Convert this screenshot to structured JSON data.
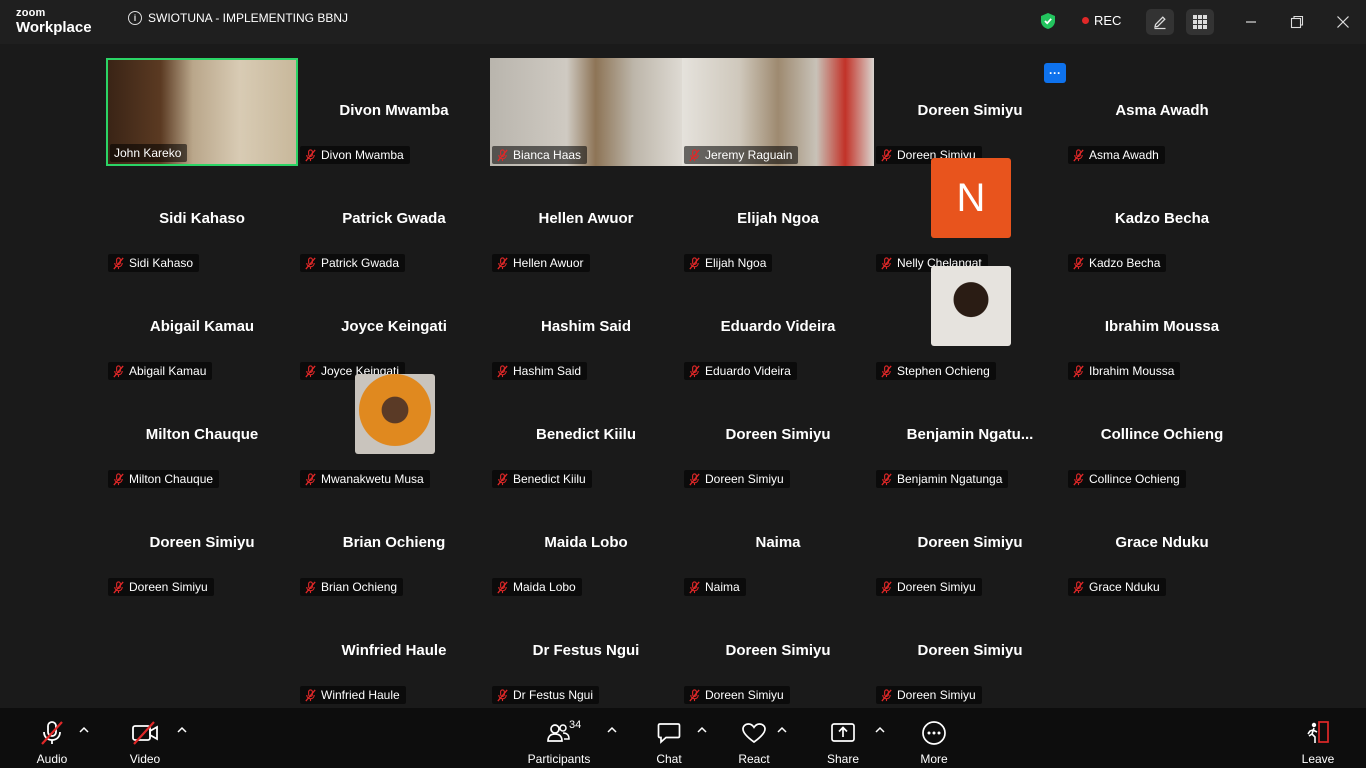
{
  "app": {
    "brand_small": "zoom",
    "brand": "Workplace"
  },
  "meeting": {
    "title": "SWIOTUNA - IMPLEMENTING BBNJ",
    "rec_label": "REC"
  },
  "colors": {
    "speaker_border": "#2bd466",
    "rec": "#e02828",
    "avatar_n": "#e8541d",
    "accent": "#0e72ed",
    "leave": "#e02828"
  },
  "tiles": [
    {
      "label": "John Kareko",
      "video": true,
      "speaker": true
    },
    {
      "label": "Divon Mwamba",
      "title": "Divon Mwamba"
    },
    {
      "label": "Bianca Haas",
      "video": true
    },
    {
      "label": "Jeremy Raguain",
      "video": true
    },
    {
      "label": "Doreen Simiyu",
      "title": "Doreen Simiyu"
    },
    {
      "label": "Asma Awadh",
      "title": "Asma Awadh"
    },
    {
      "label": "Sidi Kahaso",
      "title": "Sidi Kahaso"
    },
    {
      "label": "Patrick Gwada",
      "title": "Patrick Gwada"
    },
    {
      "label": "Hellen Awuor",
      "title": "Hellen Awuor"
    },
    {
      "label": "Elijah Ngoa",
      "title": "Elijah Ngoa"
    },
    {
      "label": "Nelly Chelangat",
      "avatar_letter": "N"
    },
    {
      "label": "Kadzo Becha",
      "title": "Kadzo Becha"
    },
    {
      "label": "Abigail Kamau",
      "title": "Abigail Kamau"
    },
    {
      "label": "Joyce Keingati",
      "title": "Joyce Keingati"
    },
    {
      "label": "Hashim Said",
      "title": "Hashim Said"
    },
    {
      "label": "Eduardo Videira",
      "title": "Eduardo Videira"
    },
    {
      "label": "Stephen Ochieng",
      "avatar_photo": true
    },
    {
      "label": "Ibrahim Moussa",
      "title": "Ibrahim Moussa"
    },
    {
      "label": "Milton Chauque",
      "title": "Milton Chauque"
    },
    {
      "label": "Mwanakwetu Musa",
      "avatar_photo": true
    },
    {
      "label": "Benedict Kiilu",
      "title": "Benedict Kiilu"
    },
    {
      "label": "Doreen Simiyu",
      "title": "Doreen Simiyu"
    },
    {
      "label": "Benjamin Ngatunga",
      "title": "Benjamin  Ngatu..."
    },
    {
      "label": "Collince Ochieng",
      "title": "Collince Ochieng"
    },
    {
      "label": "Doreen Simiyu",
      "title": "Doreen Simiyu"
    },
    {
      "label": "Brian Ochieng",
      "title": "Brian Ochieng"
    },
    {
      "label": "Maida Lobo",
      "title": "Maida Lobo"
    },
    {
      "label": "Naima",
      "title": "Naima"
    },
    {
      "label": "Doreen Simiyu",
      "title": "Doreen Simiyu"
    },
    {
      "label": "Grace Nduku",
      "title": "Grace Nduku"
    },
    {
      "label": "Winfried Haule",
      "title": "Winfried Haule"
    },
    {
      "label": "Dr Festus Ngui",
      "title": "Dr Festus Ngui"
    },
    {
      "label": "Doreen Simiyu",
      "title": "Doreen Simiyu"
    },
    {
      "label": "Doreen Simiyu",
      "title": "Doreen Simiyu"
    }
  ],
  "more_options_glyph": "···",
  "toolbar": {
    "audio": "Audio",
    "video": "Video",
    "participants": "Participants",
    "participants_count": "34",
    "chat": "Chat",
    "react": "React",
    "share": "Share",
    "more": "More",
    "leave": "Leave"
  },
  "icons": [
    "info-icon",
    "shield-icon",
    "record-icon",
    "edit-icon",
    "apps-grid-icon",
    "minimize-icon",
    "restore-icon",
    "close-icon",
    "mic-off-icon",
    "video-off-icon",
    "participants-icon",
    "chat-icon",
    "react-icon",
    "share-icon",
    "more-icon",
    "leave-icon",
    "chevron-up-icon"
  ]
}
